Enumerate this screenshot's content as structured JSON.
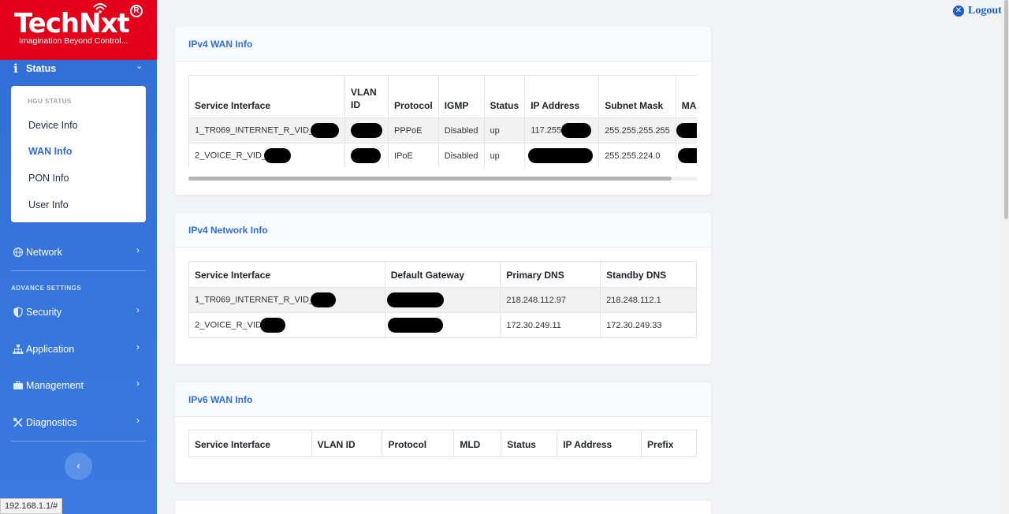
{
  "brand": {
    "name": "TechNxt",
    "reg": "R",
    "tagline": "Imagination Beyond Control..."
  },
  "sidebar": {
    "status_label": "Status",
    "submenu_header": "HGU STATUS",
    "submenu_items": [
      "Device Info",
      "WAN Info",
      "PON Info",
      "User Info"
    ],
    "network": "Network",
    "advance_header": "ADVANCE SETTINGS",
    "security": "Security",
    "application": "Application",
    "management": "Management",
    "diagnostics": "Diagnostics",
    "collapse_glyph": "‹",
    "chevron": "›",
    "chevron_down": "⌄"
  },
  "logout_label": "Logout",
  "status_url": "192.168.1.1/#",
  "ipv4_wan": {
    "title": "IPv4 WAN Info",
    "headers": [
      "Service Interface",
      "VLAN ID",
      "Protocol",
      "IGMP",
      "Status",
      "IP Address",
      "Subnet Mask",
      "MAC Addre"
    ],
    "rows": [
      {
        "iface": "1_TR069_INTERNET_R_VID_",
        "protocol": "PPPoE",
        "igmp": "Disabled",
        "status": "up",
        "ip": "117.255",
        "mask": "255.255.255.255"
      },
      {
        "iface": "2_VOICE_R_VID_",
        "protocol": "IPoE",
        "igmp": "Disabled",
        "status": "up",
        "ip": "",
        "mask": "255.255.224.0"
      }
    ]
  },
  "ipv4_net": {
    "title": "IPv4 Network Info",
    "headers": [
      "Service Interface",
      "Default Gateway",
      "Primary DNS",
      "Standby DNS"
    ],
    "rows": [
      {
        "iface": "1_TR069_INTERNET_R_VID_",
        "primary": "218.248.112.97",
        "standby": "218.248.112.1"
      },
      {
        "iface": "2_VOICE_R_VID",
        "primary": "172.30.249.11",
        "standby": "172.30.249.33"
      }
    ]
  },
  "ipv6_wan": {
    "title": "IPv6 WAN Info",
    "headers": [
      "Service Interface",
      "VLAN ID",
      "Protocol",
      "MLD",
      "Status",
      "IP Address",
      "Prefix"
    ]
  },
  "colors": {
    "brand_red": "#e4001b",
    "sidebar_blue": "#2f6fd6",
    "link_blue": "#1a5fc9"
  }
}
